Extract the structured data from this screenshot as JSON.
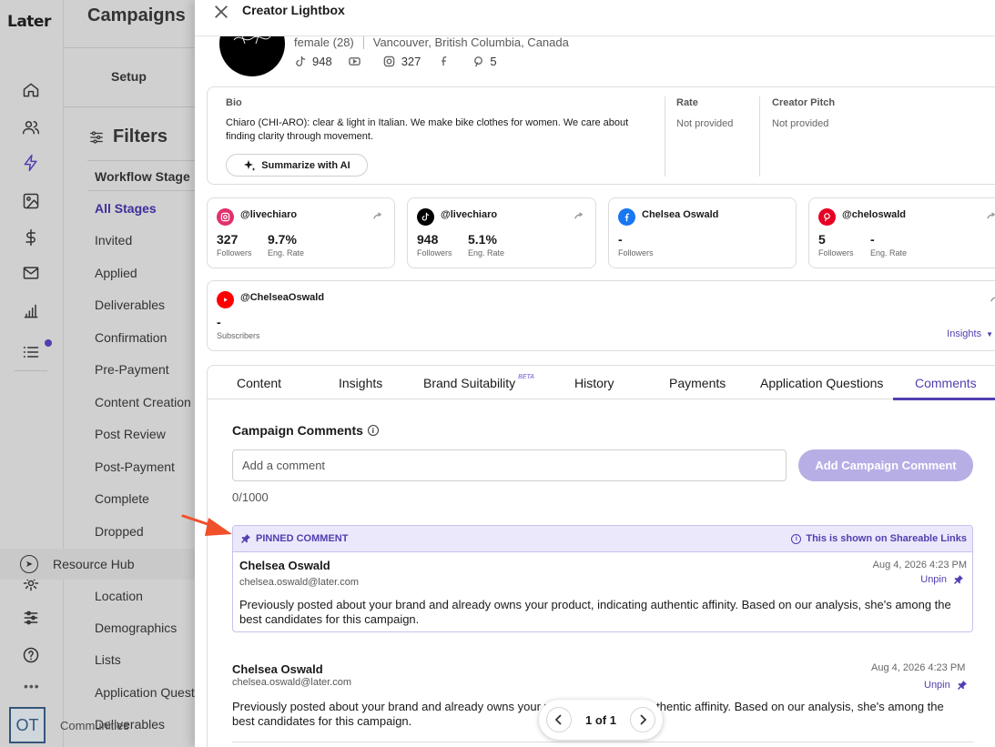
{
  "rail": {
    "logo": "Later",
    "icons": [
      "home-icon",
      "people-icon",
      "lightning-icon",
      "image-icon",
      "dollar-icon",
      "mail-icon",
      "chart-icon",
      "list-icon",
      "settings-icon",
      "sliders-icon",
      "help-icon"
    ],
    "resource_hub": "Resource Hub",
    "more": "•••",
    "avatar": "OT",
    "communities": "Communities"
  },
  "main": {
    "title": "Campaigns",
    "setup_tab": "Setup",
    "filters_title": "Filters",
    "workflow_header": "Workflow Stage",
    "stages": [
      "All Stages",
      "Invited",
      "Applied",
      "Deliverables",
      "Confirmation",
      "Pre-Payment",
      "Content Creation",
      "Post Review",
      "Post-Payment",
      "Complete",
      "Dropped"
    ],
    "more_filters": [
      "Location",
      "Demographics",
      "Lists",
      "Application Questions",
      "Deliverables"
    ]
  },
  "lightbox": {
    "title": "Creator Lightbox",
    "profile": {
      "demographic": "female (28)",
      "location": "Vancouver, British Columbia, Canada",
      "tiktok_count": "948",
      "instagram_count": "327",
      "pinterest_count": "5"
    },
    "bio": {
      "label": "Bio",
      "text": "Chiaro (CHI-ARO): clear & light in Italian. We make bike clothes for women. We care about finding clarity through movement.",
      "summarize_label": "Summarize with AI",
      "rate_label": "Rate",
      "rate_value": "Not provided",
      "pitch_label": "Creator Pitch",
      "pitch_value": "Not provided"
    },
    "socials": [
      {
        "platform": "instagram",
        "handle": "@livechiaro",
        "followers": "327",
        "followers_label": "Followers",
        "eng": "9.7%",
        "eng_label": "Eng. Rate",
        "color": "#e1306c"
      },
      {
        "platform": "tiktok",
        "handle": "@livechiaro",
        "followers": "948",
        "followers_label": "Followers",
        "eng": "5.1%",
        "eng_label": "Eng. Rate",
        "color": "#000000"
      },
      {
        "platform": "facebook",
        "handle": "Chelsea Oswald",
        "followers": "-",
        "followers_label": "Followers",
        "color": "#1877f2"
      },
      {
        "platform": "pinterest",
        "handle": "@cheloswald",
        "followers": "5",
        "followers_label": "Followers",
        "eng": "-",
        "eng_label": "Eng. Rate",
        "color": "#e60023"
      },
      {
        "platform": "youtube",
        "handle": "@ChelseaOswald",
        "followers": "-",
        "followers_label": "Subscribers",
        "color": "#ff0000",
        "insights_label": "Insights"
      }
    ],
    "tabs": [
      "Content",
      "Insights",
      "Brand Suitability",
      "History",
      "Payments",
      "Application Questions",
      "Comments"
    ],
    "beta_label": "BETA",
    "active_tab": "Comments",
    "comments": {
      "title": "Campaign Comments",
      "input_placeholder": "Add a comment",
      "add_button": "Add Campaign Comment",
      "char_count": "0/1000",
      "pinned_label": "PINNED COMMENT",
      "shareable_note": "This is shown on Shareable Links",
      "items": [
        {
          "name": "Chelsea Oswald",
          "email": "chelsea.oswald@later.com",
          "date": "Aug 4, 2026 4:23 PM",
          "action": "Unpin",
          "body": "Previously posted about your brand and already owns your product, indicating authentic affinity. Based on our analysis, she's among the best candidates for this campaign."
        },
        {
          "name": "Chelsea Oswald",
          "email": "chelsea.oswald@later.com",
          "date": "Aug 4, 2026 4:23 PM",
          "action": "Unpin",
          "body": "Previously posted about your brand and already owns your product, indicating authentic affinity. Based on our analysis, she's among the best candidates for this campaign."
        }
      ]
    },
    "pager": {
      "text": "1 of 1"
    }
  },
  "colors": {
    "accent": "#4f3fb0",
    "accent_light": "#ece8fb",
    "button_disabled": "#b7aee6",
    "arrow": "#f0502a"
  }
}
